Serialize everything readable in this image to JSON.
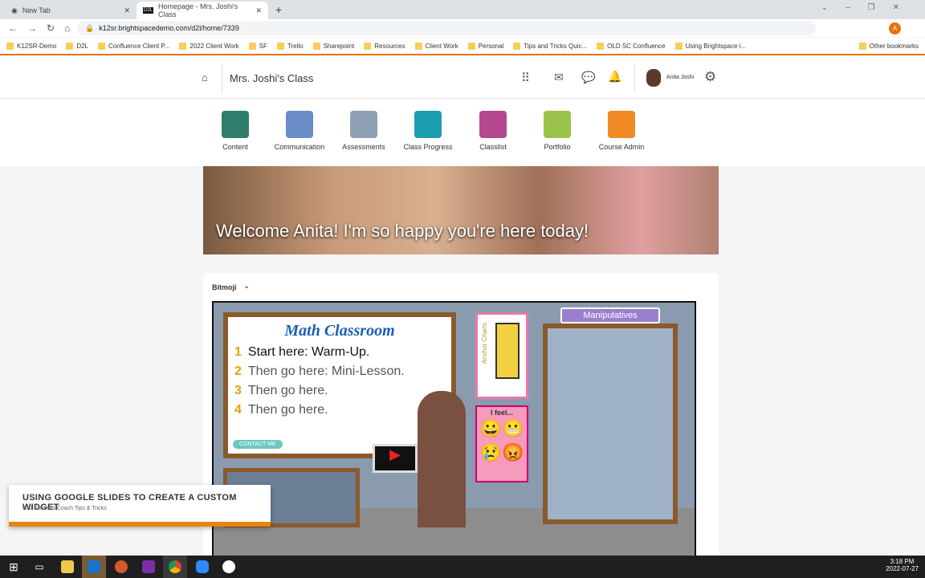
{
  "browser": {
    "tabs": [
      {
        "label": "New Tab"
      },
      {
        "label": "Homepage - Mrs. Joshi's Class"
      }
    ],
    "url": "k12sr.brightspacedemo.com/d2l/home/7339",
    "profile_initial": "A",
    "bookmarks": [
      "K12SR-Demo",
      "D2L",
      "Confluence Client P...",
      "2022 Client Work",
      "SF",
      "Trello",
      "Sharepoint",
      "Resources",
      "Client Work",
      "Personal",
      "Tips and Tricks Quic...",
      "OLD SC Confluence",
      "Using Brightspace i..."
    ],
    "other_bookmarks": "Other bookmarks"
  },
  "header": {
    "course_title": "Mrs. Joshi's Class",
    "user_name": "Anita Joshi"
  },
  "nav": [
    {
      "label": "Content",
      "color": "#2f7d6b"
    },
    {
      "label": "Communication",
      "color": "#6a8cc7"
    },
    {
      "label": "Assessments",
      "color": "#8fa0b5"
    },
    {
      "label": "Class Progress",
      "color": "#1c9fb0"
    },
    {
      "label": "Classlist",
      "color": "#b5478f"
    },
    {
      "label": "Portfolio",
      "color": "#9bc34a"
    },
    {
      "label": "Course Admin",
      "color": "#f08a24"
    }
  ],
  "banner": {
    "text": "Welcome Anita! I'm so happy you're here today!"
  },
  "widget": {
    "title": "Bitmoji",
    "board_title": "Math Classroom",
    "steps": [
      "Start here: Warm-Up.",
      "Then go here: Mini-Lesson.",
      "Then go here.",
      "Then go here."
    ],
    "contact": "CONTACT ME",
    "anchor_charts": "Anchor Charts",
    "i_feel": "I feel...",
    "manipulatives": "Manipulatives"
  },
  "lower_third": {
    "title": "USING GOOGLE SLIDES TO CREATE A CUSTOM WIDGET",
    "subtitle": "K12 Success Coach Tips & Tricks"
  },
  "clock": {
    "time": "3:18 PM",
    "date": "2022-07-27"
  }
}
